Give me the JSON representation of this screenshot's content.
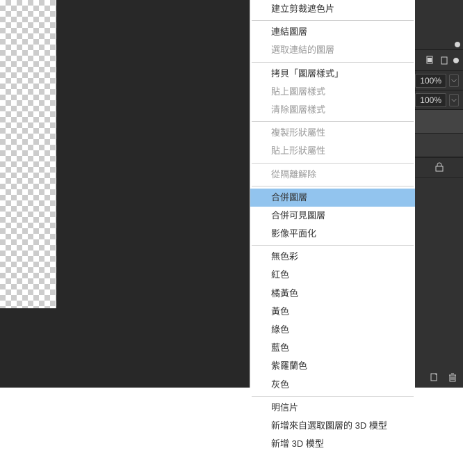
{
  "menu": {
    "items": [
      {
        "label": "建立剪裁遮色片",
        "disabled": false
      },
      null,
      {
        "label": "連結圖層",
        "disabled": false
      },
      {
        "label": "選取連結的圖層",
        "disabled": true
      },
      null,
      {
        "label": "拷貝「圖層樣式」",
        "disabled": false
      },
      {
        "label": "貼上圖層樣式",
        "disabled": true
      },
      {
        "label": "清除圖層樣式",
        "disabled": true
      },
      null,
      {
        "label": "複製形狀屬性",
        "disabled": true
      },
      {
        "label": "貼上形狀屬性",
        "disabled": true
      },
      null,
      {
        "label": "從隔離解除",
        "disabled": true
      },
      null,
      {
        "label": "合併圖層",
        "disabled": false,
        "highlight": true
      },
      {
        "label": "合併可見圖層",
        "disabled": false
      },
      {
        "label": "影像平面化",
        "disabled": false
      },
      null,
      {
        "label": "無色彩",
        "disabled": false
      },
      {
        "label": "紅色",
        "disabled": false
      },
      {
        "label": "橘黃色",
        "disabled": false
      },
      {
        "label": "黃色",
        "disabled": false
      },
      {
        "label": "綠色",
        "disabled": false
      },
      {
        "label": "藍色",
        "disabled": false
      },
      {
        "label": "紫羅蘭色",
        "disabled": false
      },
      {
        "label": "灰色",
        "disabled": false
      },
      null,
      {
        "label": "明信片",
        "disabled": false
      },
      {
        "label": "新增來自選取圖層的 3D 模型",
        "disabled": false
      },
      {
        "label": "新增 3D 模型",
        "disabled": false
      }
    ]
  },
  "right_panel": {
    "opacity": "100%",
    "fill": "100%"
  }
}
